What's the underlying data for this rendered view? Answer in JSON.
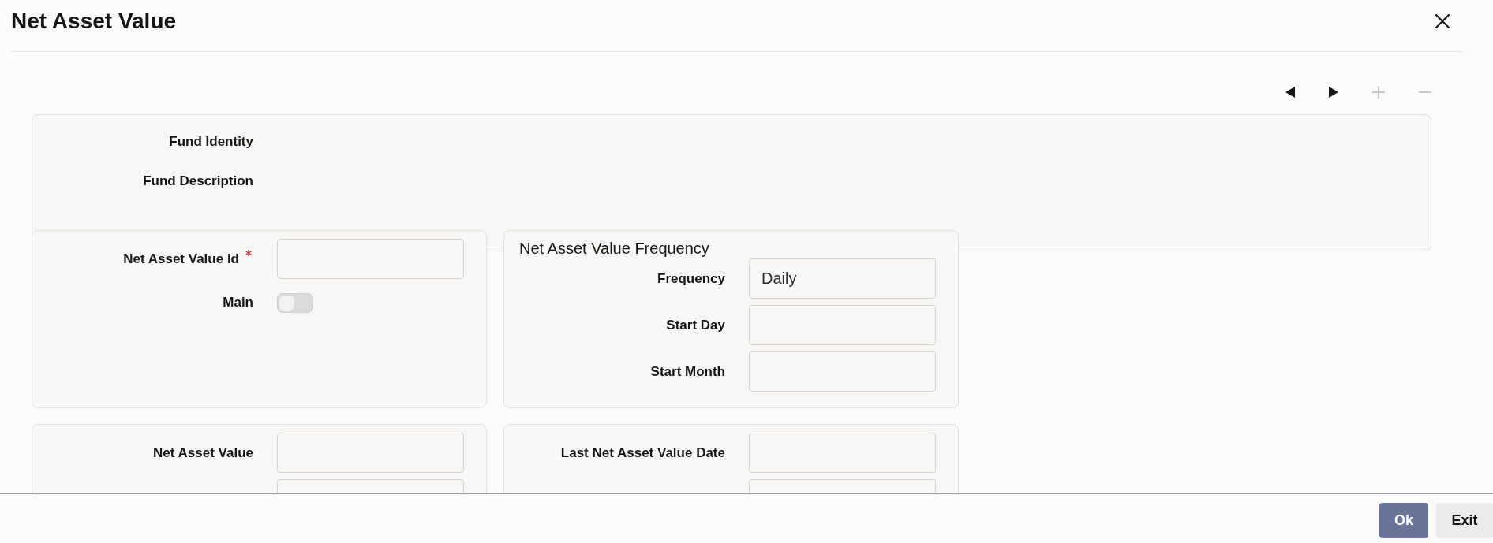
{
  "window": {
    "title": "Net Asset Value"
  },
  "toolbar": [
    {
      "kind": "previous",
      "disabled": false
    },
    {
      "kind": "next",
      "disabled": false
    },
    {
      "kind": "add",
      "disabled": true
    },
    {
      "kind": "remove",
      "disabled": true
    }
  ],
  "header": {
    "labels": [
      "Fund Identity",
      "Fund Description"
    ]
  },
  "panels": [
    {
      "fields": [
        {
          "kind": "text",
          "label": "Net Asset Value Id",
          "required": true
        },
        {
          "kind": "toggle",
          "label": "Main",
          "on": false
        }
      ]
    },
    {
      "title": "Net Asset Value Frequency",
      "fields": [
        {
          "kind": "text",
          "label": "Frequency",
          "value": "Daily",
          "required": false
        },
        {
          "kind": "text",
          "label": "Start Day",
          "required": false
        },
        {
          "kind": "text",
          "label": "Start Month",
          "required": false
        }
      ]
    },
    {
      "fields": [
        {
          "kind": "text",
          "label": "Net Asset Value",
          "required": false
        },
        {
          "kind": "text",
          "required": false
        }
      ]
    },
    {
      "fields": [
        {
          "kind": "text",
          "label": "Last Net Asset Value Date",
          "required": false
        },
        {
          "kind": "text",
          "required": false
        }
      ]
    }
  ],
  "footer": {
    "buttons": [
      {
        "kind": "primary",
        "label": "Ok"
      },
      {
        "kind": "secondary",
        "label": "Exit"
      }
    ]
  }
}
